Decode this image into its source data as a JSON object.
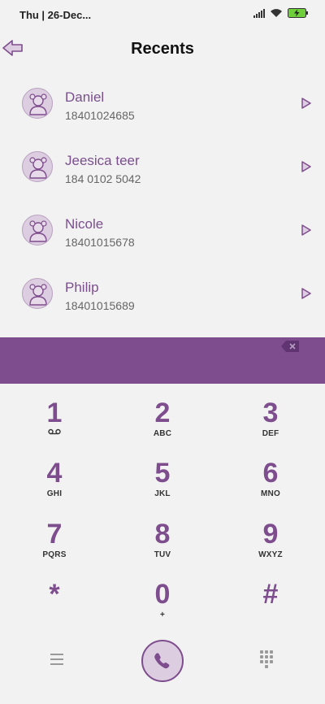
{
  "status": {
    "time": "Thu | 26-Dec..."
  },
  "header": {
    "title": "Recents"
  },
  "recents": [
    {
      "name": "Daniel",
      "number": "18401024685"
    },
    {
      "name": "Jeesica teer",
      "number": "184 0102 5042"
    },
    {
      "name": "Nicole",
      "number": "18401015678"
    },
    {
      "name": "Philip",
      "number": "18401015689"
    }
  ],
  "display": {
    "value": ""
  },
  "keypad": [
    {
      "digit": "1",
      "letters": ""
    },
    {
      "digit": "2",
      "letters": "ABC"
    },
    {
      "digit": "3",
      "letters": "DEF"
    },
    {
      "digit": "4",
      "letters": "GHI"
    },
    {
      "digit": "5",
      "letters": "JKL"
    },
    {
      "digit": "6",
      "letters": "MNO"
    },
    {
      "digit": "7",
      "letters": "PQRS"
    },
    {
      "digit": "8",
      "letters": "TUV"
    },
    {
      "digit": "9",
      "letters": "WXYZ"
    },
    {
      "digit": "*",
      "letters": ""
    },
    {
      "digit": "0",
      "letters": "+"
    },
    {
      "digit": "#",
      "letters": ""
    }
  ],
  "colors": {
    "accent": "#7e4d8d",
    "accent_light": "#dccde0",
    "background": "#f2f2f2"
  }
}
